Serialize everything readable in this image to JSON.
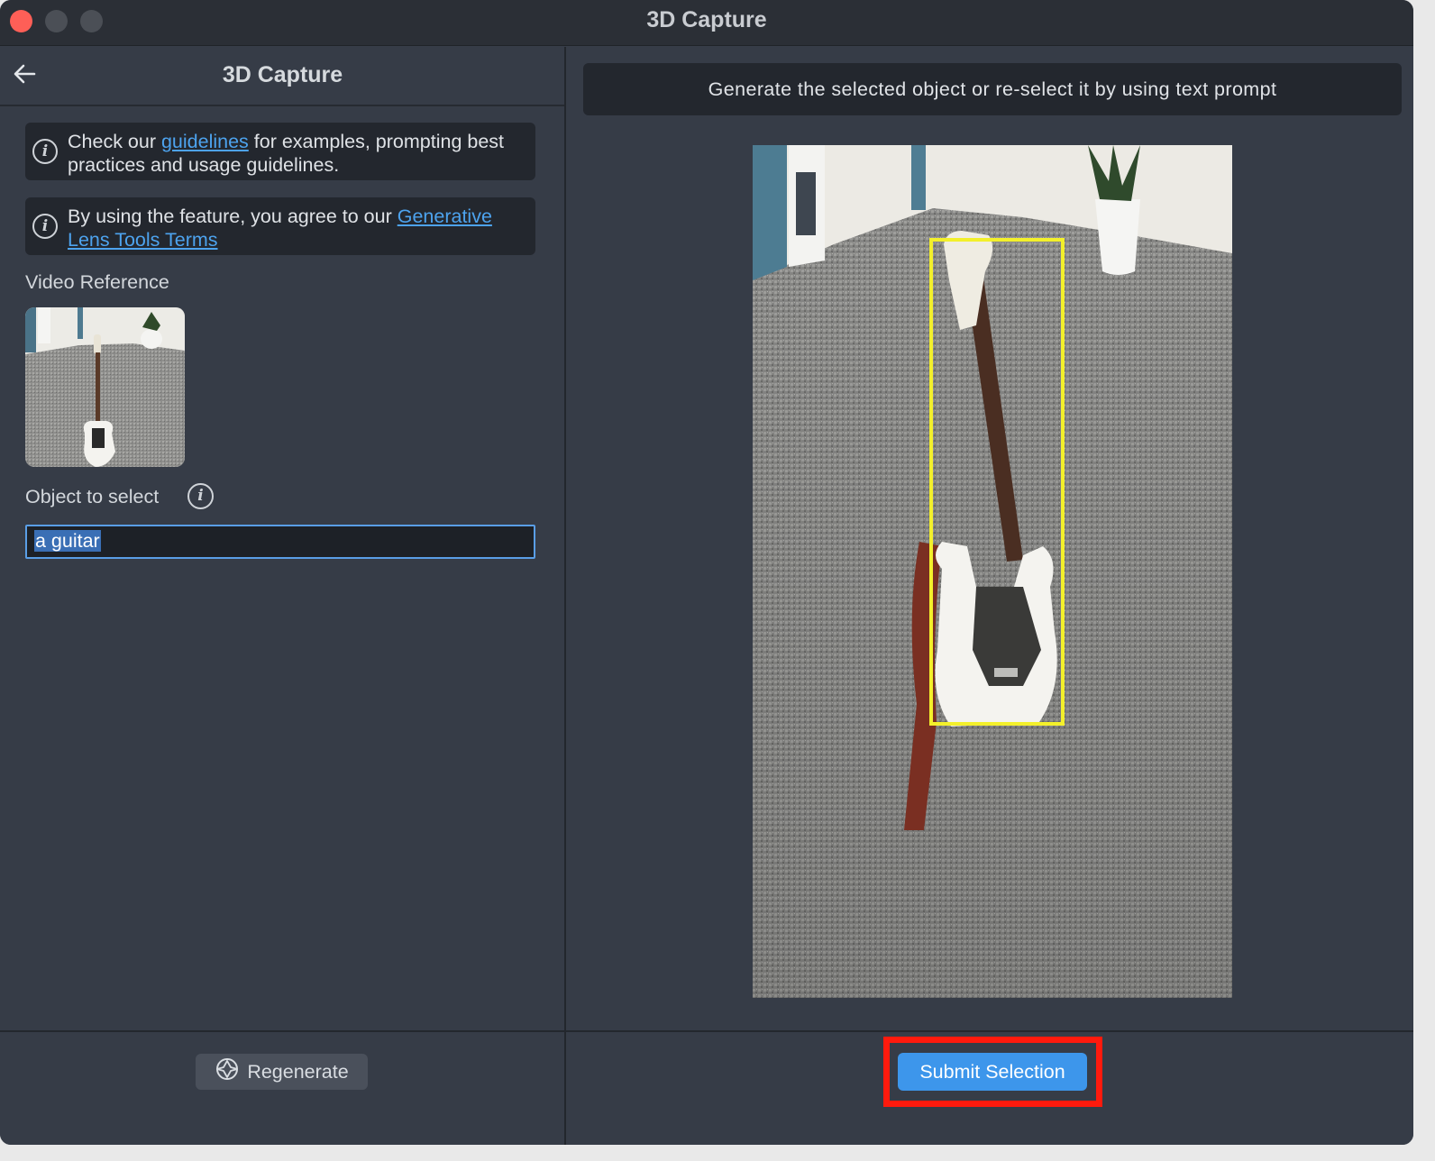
{
  "window": {
    "title": "3D Capture"
  },
  "left_panel": {
    "title": "3D Capture",
    "notices": [
      {
        "prefix": "Check our ",
        "link": "guidelines",
        "suffix": " for examples, prompting best practices and usage guidelines."
      },
      {
        "prefix": "By using the feature, you agree to our ",
        "link": "Generative Lens Tools Terms",
        "suffix": ""
      }
    ],
    "video_reference_label": "Video Reference",
    "object_label": "Object to select",
    "object_input_value": "a guitar",
    "regenerate_label": "Regenerate"
  },
  "right_panel": {
    "prompt_banner": "Generate the selected object or re-select it by using text prompt",
    "submit_label": "Submit Selection"
  },
  "colors": {
    "accent": "#3d96eb",
    "selection_box": "#f3f02b",
    "highlight_outline": "#ff1a0d",
    "link": "#4da3ee"
  },
  "icons": [
    "back-arrow-icon",
    "info-icon",
    "regenerate-icon"
  ]
}
